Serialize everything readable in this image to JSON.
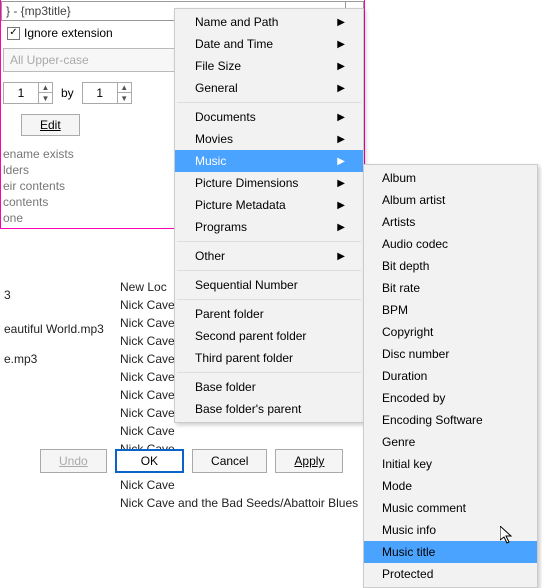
{
  "pattern": {
    "value": "} - {mp3title}"
  },
  "ignore_ext": {
    "checked": true,
    "label": "Ignore extension"
  },
  "case_field": "All Upper-case",
  "spin": {
    "a": "1",
    "by_label": "by",
    "b": "1"
  },
  "edit_label": "Edit",
  "warnings": {
    "exists": "ename exists",
    "folders": "lders",
    "contents": "eir contents",
    "contents2": "contents",
    "none": "one"
  },
  "file_list": [
    "",
    "",
    "3",
    "",
    "",
    "",
    "",
    "eautiful World.mp3",
    "",
    "",
    "",
    "e.mp3",
    ""
  ],
  "newloc_header": "New Loc",
  "newloc_list": [
    "Nick Cave",
    "Nick Cave",
    "Nick Cave",
    "Nick Cave",
    "Nick Cave",
    "Nick Cave",
    "Nick Cave",
    "Nick Cave",
    "Nick Cave",
    "Nick Cave",
    "Nick Cave",
    "Nick Cave and the Bad Seeds/Abattoir Blues"
  ],
  "buttons": {
    "undo": "Undo",
    "ok": "OK",
    "cancel": "Cancel",
    "apply": "Apply"
  },
  "menu": {
    "items": [
      {
        "label": "Name and Path",
        "arrow": true
      },
      {
        "label": "Date and Time",
        "arrow": true
      },
      {
        "label": "File Size",
        "arrow": true
      },
      {
        "label": "General",
        "arrow": true
      },
      {
        "sep": true
      },
      {
        "label": "Documents",
        "arrow": true
      },
      {
        "label": "Movies",
        "arrow": true
      },
      {
        "label": "Music",
        "arrow": true,
        "hl": true
      },
      {
        "label": "Picture Dimensions",
        "arrow": true
      },
      {
        "label": "Picture Metadata",
        "arrow": true
      },
      {
        "label": "Programs",
        "arrow": true
      },
      {
        "sep": true
      },
      {
        "label": "Other",
        "arrow": true
      },
      {
        "sep": true
      },
      {
        "label": "Sequential Number"
      },
      {
        "sep": true
      },
      {
        "label": "Parent folder"
      },
      {
        "label": "Second parent folder"
      },
      {
        "label": "Third parent folder"
      },
      {
        "sep": true
      },
      {
        "label": "Base folder"
      },
      {
        "label": "Base folder's parent"
      }
    ]
  },
  "submenu": {
    "items": [
      "Album",
      "Album artist",
      "Artists",
      "Audio codec",
      "Bit depth",
      "Bit rate",
      "BPM",
      "Copyright",
      "Disc number",
      "Duration",
      "Encoded by",
      "Encoding Software",
      "Genre",
      "Initial key",
      "Mode",
      "Music comment",
      "Music info",
      "Music title",
      "Protected"
    ],
    "highlight_index": 17
  }
}
